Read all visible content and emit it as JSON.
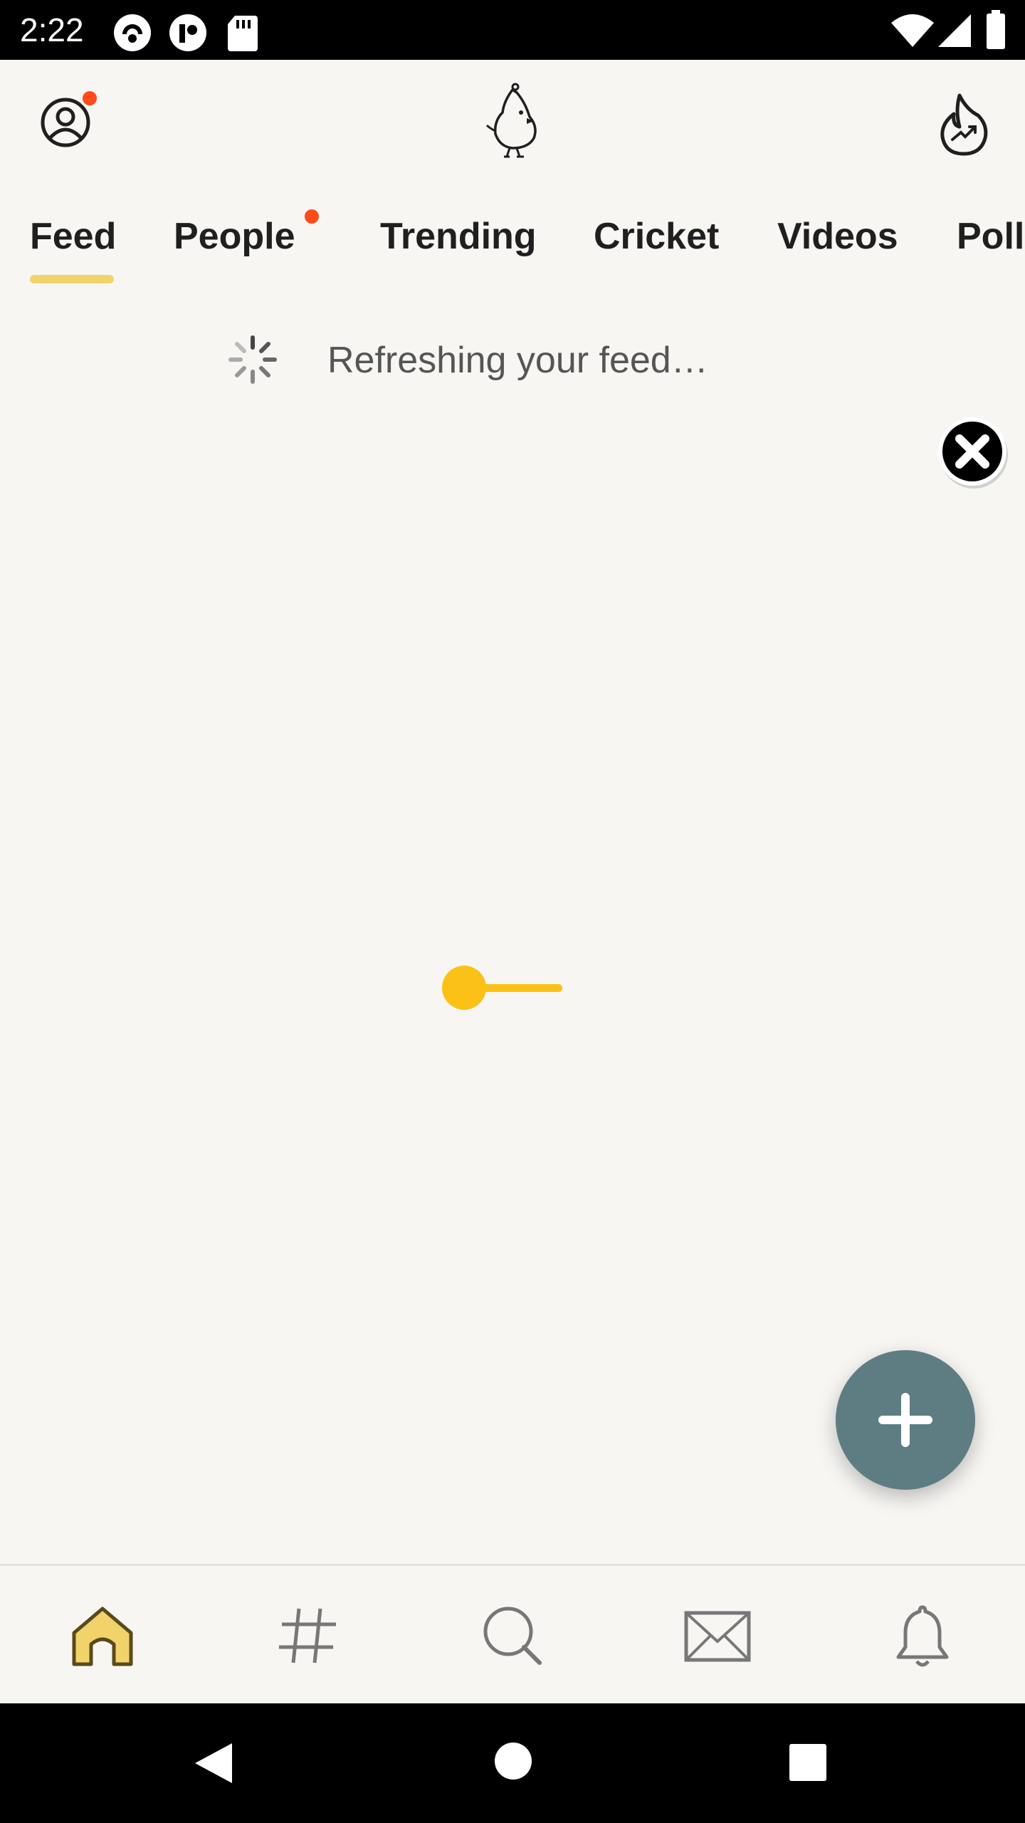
{
  "status_bar": {
    "time": "2:22",
    "icons": [
      "app-notification-icon",
      "app-notification-icon-2",
      "sd-card-icon",
      "wifi-icon",
      "cell-signal-icon",
      "battery-icon"
    ]
  },
  "header": {
    "profile_icon": "profile-icon",
    "logo_icon": "koo-bird-logo",
    "trending_icon": "trending-fire-icon",
    "notification_dot_color": "#ff4a1c"
  },
  "tabs": [
    {
      "label": "Feed",
      "active": true
    },
    {
      "label": "People",
      "has_dot": true
    },
    {
      "label": "Trending"
    },
    {
      "label": "Cricket"
    },
    {
      "label": "Videos"
    },
    {
      "label": "Poll"
    }
  ],
  "feed": {
    "refresh_text": "Refreshing your feed…"
  },
  "fab": {
    "icon": "plus-icon",
    "color": "#5e7d82"
  },
  "bottom_nav": [
    {
      "icon": "home-icon",
      "active": true
    },
    {
      "icon": "hashtag-icon"
    },
    {
      "icon": "search-icon"
    },
    {
      "icon": "mail-icon"
    },
    {
      "icon": "bell-icon"
    }
  ],
  "system_nav": [
    "back-icon",
    "home-circle-icon",
    "recents-icon"
  ],
  "colors": {
    "accent_yellow": "#f2d36b",
    "loader_yellow": "#fbc117",
    "background": "#f7f6f3"
  }
}
